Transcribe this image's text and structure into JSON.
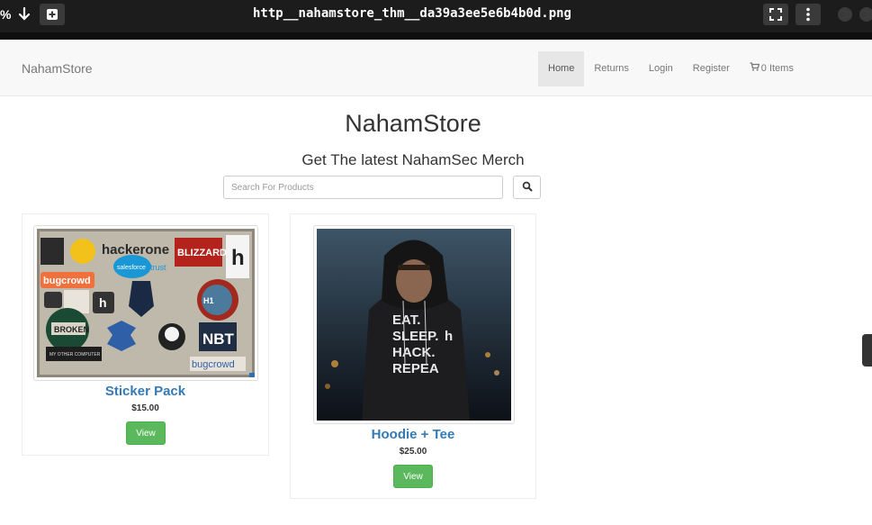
{
  "viewer": {
    "zoom_label": "%",
    "file_title": "http__nahamstore_thm__da39a3ee5e6b4b0d.png"
  },
  "navbar": {
    "brand": "NahamStore",
    "items": [
      {
        "label": "Home",
        "active": true
      },
      {
        "label": "Returns",
        "active": false
      },
      {
        "label": "Login",
        "active": false
      },
      {
        "label": "Register",
        "active": false
      }
    ],
    "cart_label": "0 Items",
    "cart_icon": "shopping-cart-icon"
  },
  "hero": {
    "title": "NahamStore",
    "tagline": "Get The latest NahamSec Merch"
  },
  "search": {
    "placeholder": "Search For Products",
    "value": "",
    "icon": "search-icon"
  },
  "products": [
    {
      "name": "Sticker Pack",
      "price": "$15.00",
      "button": "View",
      "image_text": [
        "hackerone",
        "BLIZZARD",
        "bugcrowd",
        "salesforce",
        "trust",
        "BROKEN",
        "NBT",
        "bugcrowd"
      ]
    },
    {
      "name": "Hoodie + Tee",
      "price": "$25.00",
      "button": "View",
      "image_text": [
        "EAT.",
        "SLEEP.",
        "HACK.",
        "REPEA"
      ]
    }
  ],
  "colors": {
    "link": "#337ab7",
    "button_green": "#5cb85c",
    "navbar_bg": "#f8f8f8",
    "viewer_bg": "#1c1c1c"
  }
}
